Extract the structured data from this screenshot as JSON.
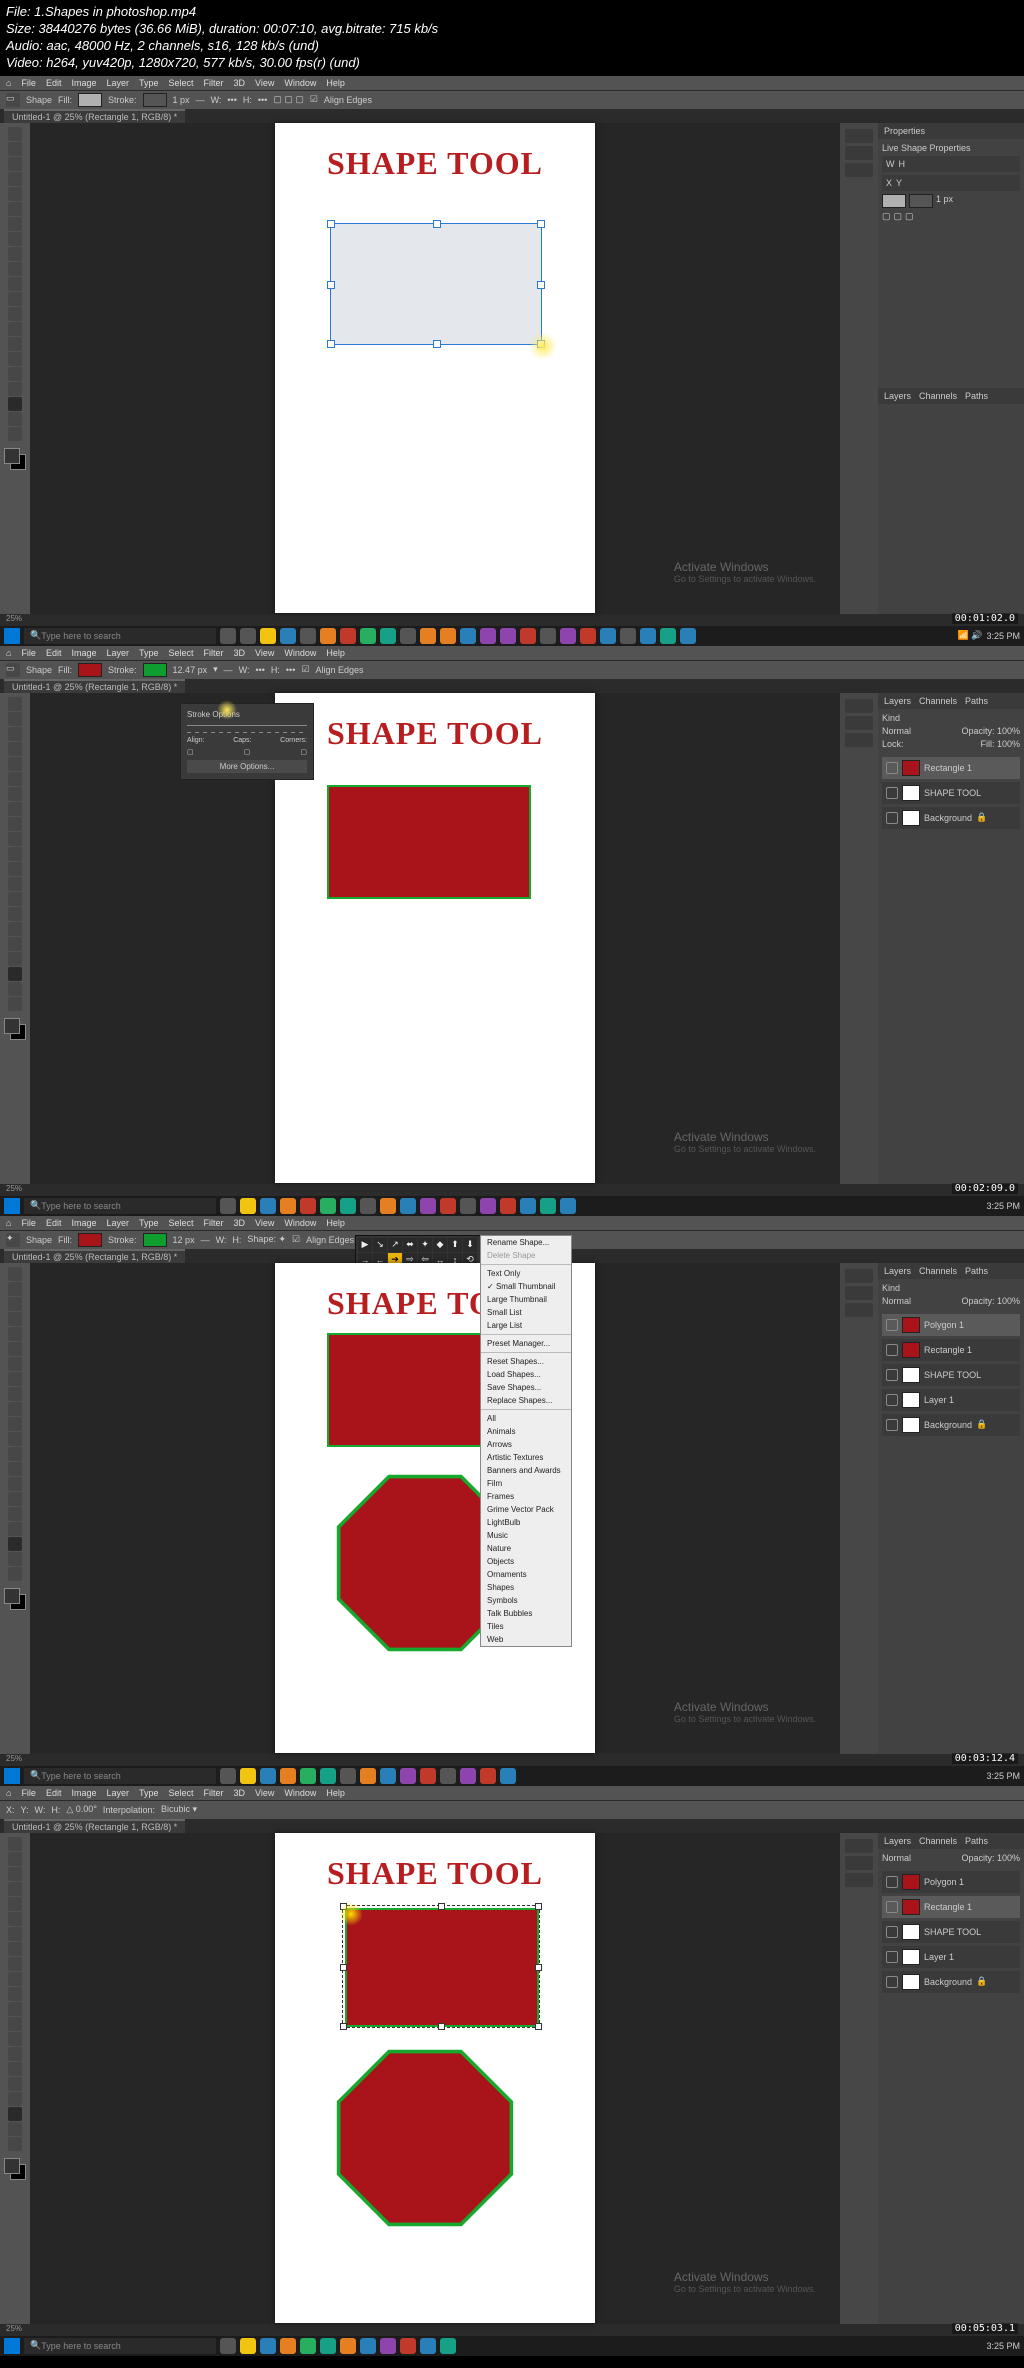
{
  "file_info": {
    "line1": "File: 1.Shapes in photoshop.mp4",
    "line2": "Size: 38440276 bytes (36.66 MiB), duration: 00:07:10, avg.bitrate: 715 kb/s",
    "line3": "Audio: aac, 48000 Hz, 2 channels, s16, 128 kb/s (und)",
    "line4": "Video: h264, yuv420p, 1280x720, 577 kb/s, 30.00 fps(r) (und)"
  },
  "menu": [
    "File",
    "Edit",
    "Image",
    "Layer",
    "Type",
    "Select",
    "Filter",
    "3D",
    "View",
    "Window",
    "Help"
  ],
  "tab_name": "Untitled-1 @ 25% (Rectangle 1, RGB/8) *",
  "canvas_title": "SHAPE TOOL",
  "options_bar": {
    "mode_label": "Shape",
    "fill_label": "Fill:",
    "stroke_label": "Stroke:",
    "stroke_px": "12.47 px",
    "w_label": "W:",
    "h_label": "H:",
    "align": "Align Edges"
  },
  "panels": {
    "properties_tab": "Properties",
    "live_shape": "Live Shape Properties",
    "layers_tab": "Layers",
    "channels_tab": "Channels",
    "paths_tab": "Paths",
    "kind_label": "Kind",
    "normal": "Normal",
    "opacity_label": "Opacity:",
    "opacity_val": "100%",
    "lock_label": "Lock:",
    "fill_label": "Fill:",
    "fill_val": "100%"
  },
  "layers_set1": [
    "Rectangle 1",
    "SHAPE TOOL",
    "Background"
  ],
  "layers_set3": [
    "Polygon 1",
    "Rectangle 1",
    "SHAPE TOOL",
    "Layer 1",
    "Background"
  ],
  "watermark": {
    "title": "Activate Windows",
    "sub": "Go to Settings to activate Windows."
  },
  "search_placeholder": "Type here to search",
  "stroke_popup": {
    "title": "Stroke Options",
    "align": "Align:",
    "caps": "Caps:",
    "corners": "Corners:",
    "more": "More Options..."
  },
  "shapes_ctx": {
    "rename": "Rename Shape...",
    "delete": "Delete Shape",
    "text_only": "Text Only",
    "small_thumb": "Small Thumbnail",
    "large_thumb": "Large Thumbnail",
    "small_list": "Small List",
    "large_list": "Large List",
    "preset_mgr": "Preset Manager...",
    "reset": "Reset Shapes...",
    "load": "Load Shapes...",
    "save": "Save Shapes...",
    "replace": "Replace Shapes...",
    "all": "All",
    "animals": "Animals",
    "arrows": "Arrows",
    "artistic": "Artistic Textures",
    "banners": "Banners and Awards",
    "film": "Film",
    "frames": "Frames",
    "grime": "Grime Vector Pack",
    "lightbulb": "LightBulb",
    "music": "Music",
    "nature": "Nature",
    "objects": "Objects",
    "ornaments": "Ornaments",
    "shapes": "Shapes",
    "symbols": "Symbols",
    "talk": "Talk Bubbles",
    "tiles": "Tiles",
    "web": "Web"
  },
  "timestamps": [
    "00:01:02.0",
    "00:02:09.0",
    "00:03:12.4",
    "00:05:03.1"
  ],
  "clock": "3:25 PM",
  "status_zoom": "25%"
}
